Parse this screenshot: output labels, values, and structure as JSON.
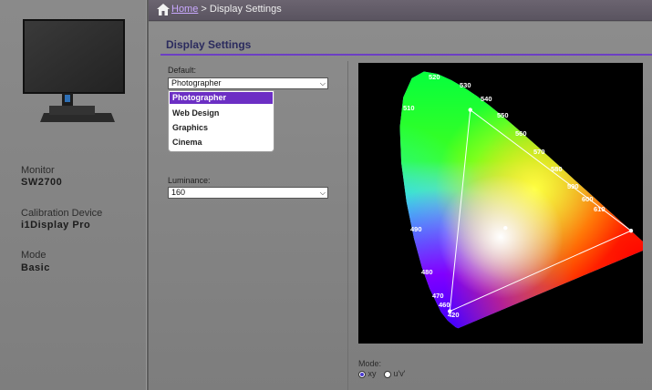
{
  "header": {
    "home_link": "Home",
    "separator": ">",
    "current_page": "Display Settings"
  },
  "sidebar": {
    "monitor_label": "Monitor",
    "monitor_value": "SW2700",
    "device_label": "Calibration Device",
    "device_value": "i1Display Pro",
    "mode_label": "Mode",
    "mode_value": "Basic"
  },
  "main": {
    "title": "Display Settings",
    "default_label": "Default:",
    "default_value": "Photographer",
    "default_options": [
      "Photographer",
      "Web Design",
      "Graphics",
      "Cinema"
    ],
    "luminance_label": "Luminance:",
    "luminance_value": "160"
  },
  "chart_data": {
    "type": "scatter",
    "title": "",
    "wavelength_labels": [
      "520",
      "530",
      "540",
      "550",
      "560",
      "570",
      "580",
      "590",
      "600",
      "610",
      "510",
      "490",
      "480",
      "470",
      "460",
      "420"
    ],
    "gamut_triangle": [
      {
        "x": 0.21,
        "y": 0.71
      },
      {
        "x": 0.68,
        "y": 0.32
      },
      {
        "x": 0.15,
        "y": 0.06
      }
    ],
    "white_point": {
      "x": 0.3127,
      "y": 0.329
    }
  },
  "mode": {
    "label": "Mode:",
    "options": [
      "xy",
      "u'v'"
    ],
    "selected": "xy"
  },
  "colors": {
    "accent": "#6c2fc4",
    "topbar": "#5e5864",
    "link": "#c9a9ff"
  }
}
